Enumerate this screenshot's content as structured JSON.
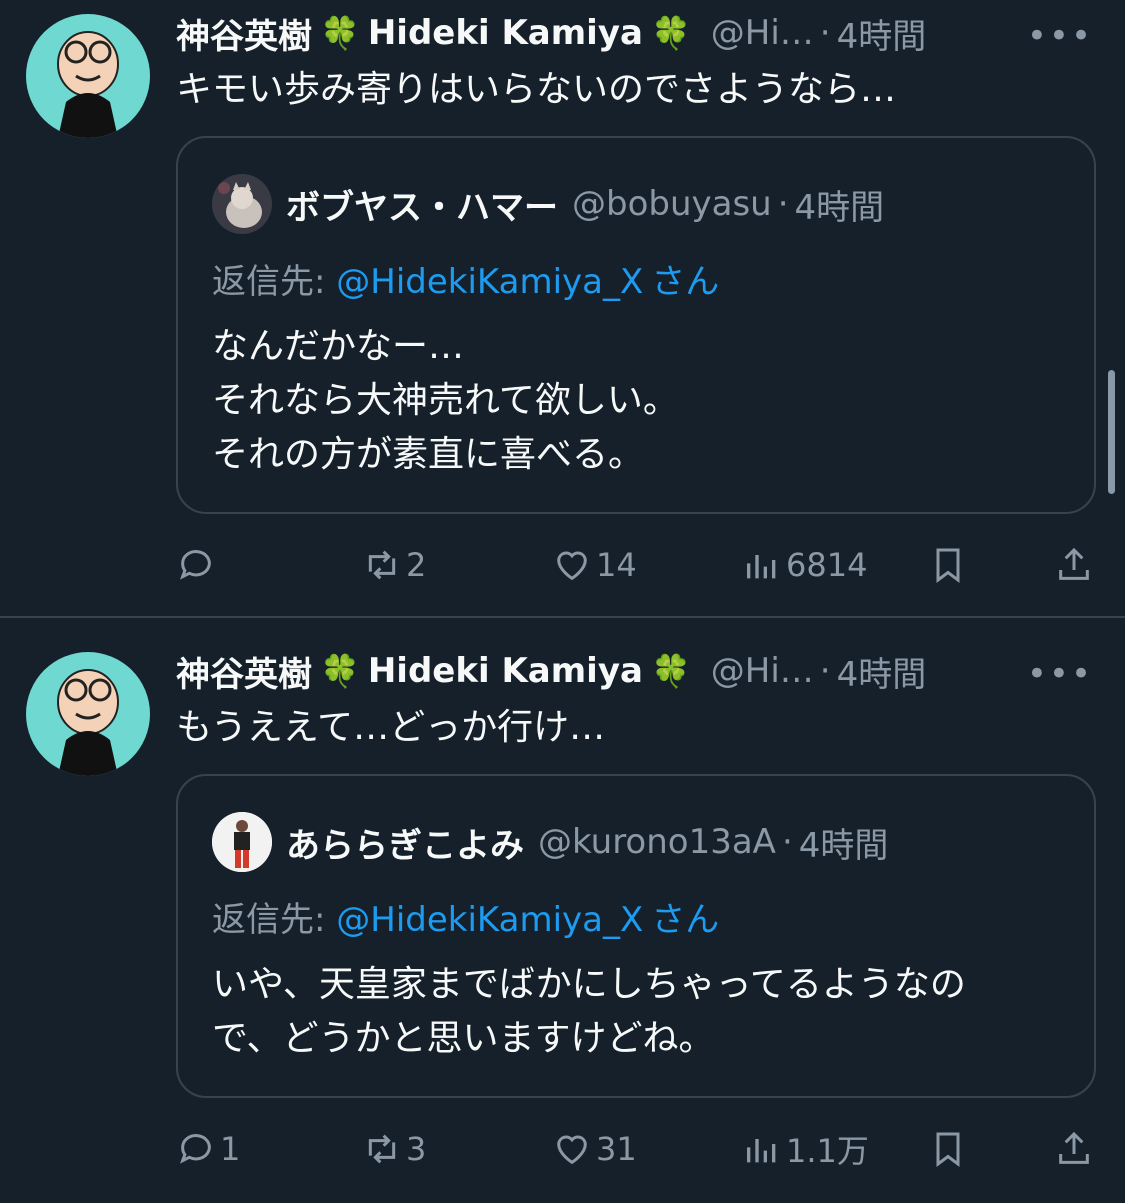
{
  "colors": {
    "background": "#15202b",
    "text": "#f7f9f9",
    "muted": "#8b98a5",
    "link": "#1d9bf0",
    "border": "#38444d",
    "avatar_bg": "#6fd8d0"
  },
  "tweets": [
    {
      "author_name": "神谷英樹",
      "author_name_en": "Hideki Kamiya",
      "handle": "@Hi…",
      "dot": "·",
      "time": "4時間",
      "more": "•••",
      "text": "キモい歩み寄りはいらないのでさようなら…",
      "quote": {
        "name": "ボブヤス・ハマー",
        "handle": "@bobuyasu",
        "dot": "·",
        "time": "4時間",
        "reply_prefix": "返信先: ",
        "reply_mention": "@HidekiKamiya_X",
        "reply_suffix": "さん",
        "lines": [
          "なんだかなー…",
          "それなら大神売れて欲しい。",
          "それの方が素直に喜べる。"
        ]
      },
      "actions": {
        "reply": "",
        "retweet": "2",
        "like": "14",
        "views": "6814"
      }
    },
    {
      "author_name": "神谷英樹",
      "author_name_en": "Hideki Kamiya",
      "handle": "@Hi…",
      "dot": "·",
      "time": "4時間",
      "more": "•••",
      "text": "もうええて…どっか行け…",
      "quote": {
        "name": "あららぎこよみ",
        "handle": "@kurono13aA",
        "dot": "·",
        "time": "4時間",
        "reply_prefix": "返信先: ",
        "reply_mention": "@HidekiKamiya_X",
        "reply_suffix": "さん",
        "lines": [
          "いや、天皇家までばかにしちゃってるようなの",
          "で、どうかと思いますけどね。"
        ]
      },
      "actions": {
        "reply": "1",
        "retweet": "3",
        "like": "31",
        "views": "1.1万"
      }
    }
  ],
  "icons": {
    "clover": "🍀",
    "reply": "reply-icon",
    "retweet": "retweet-icon",
    "like": "heart-icon",
    "views": "views-icon",
    "bookmark": "bookmark-icon",
    "share": "share-icon"
  }
}
